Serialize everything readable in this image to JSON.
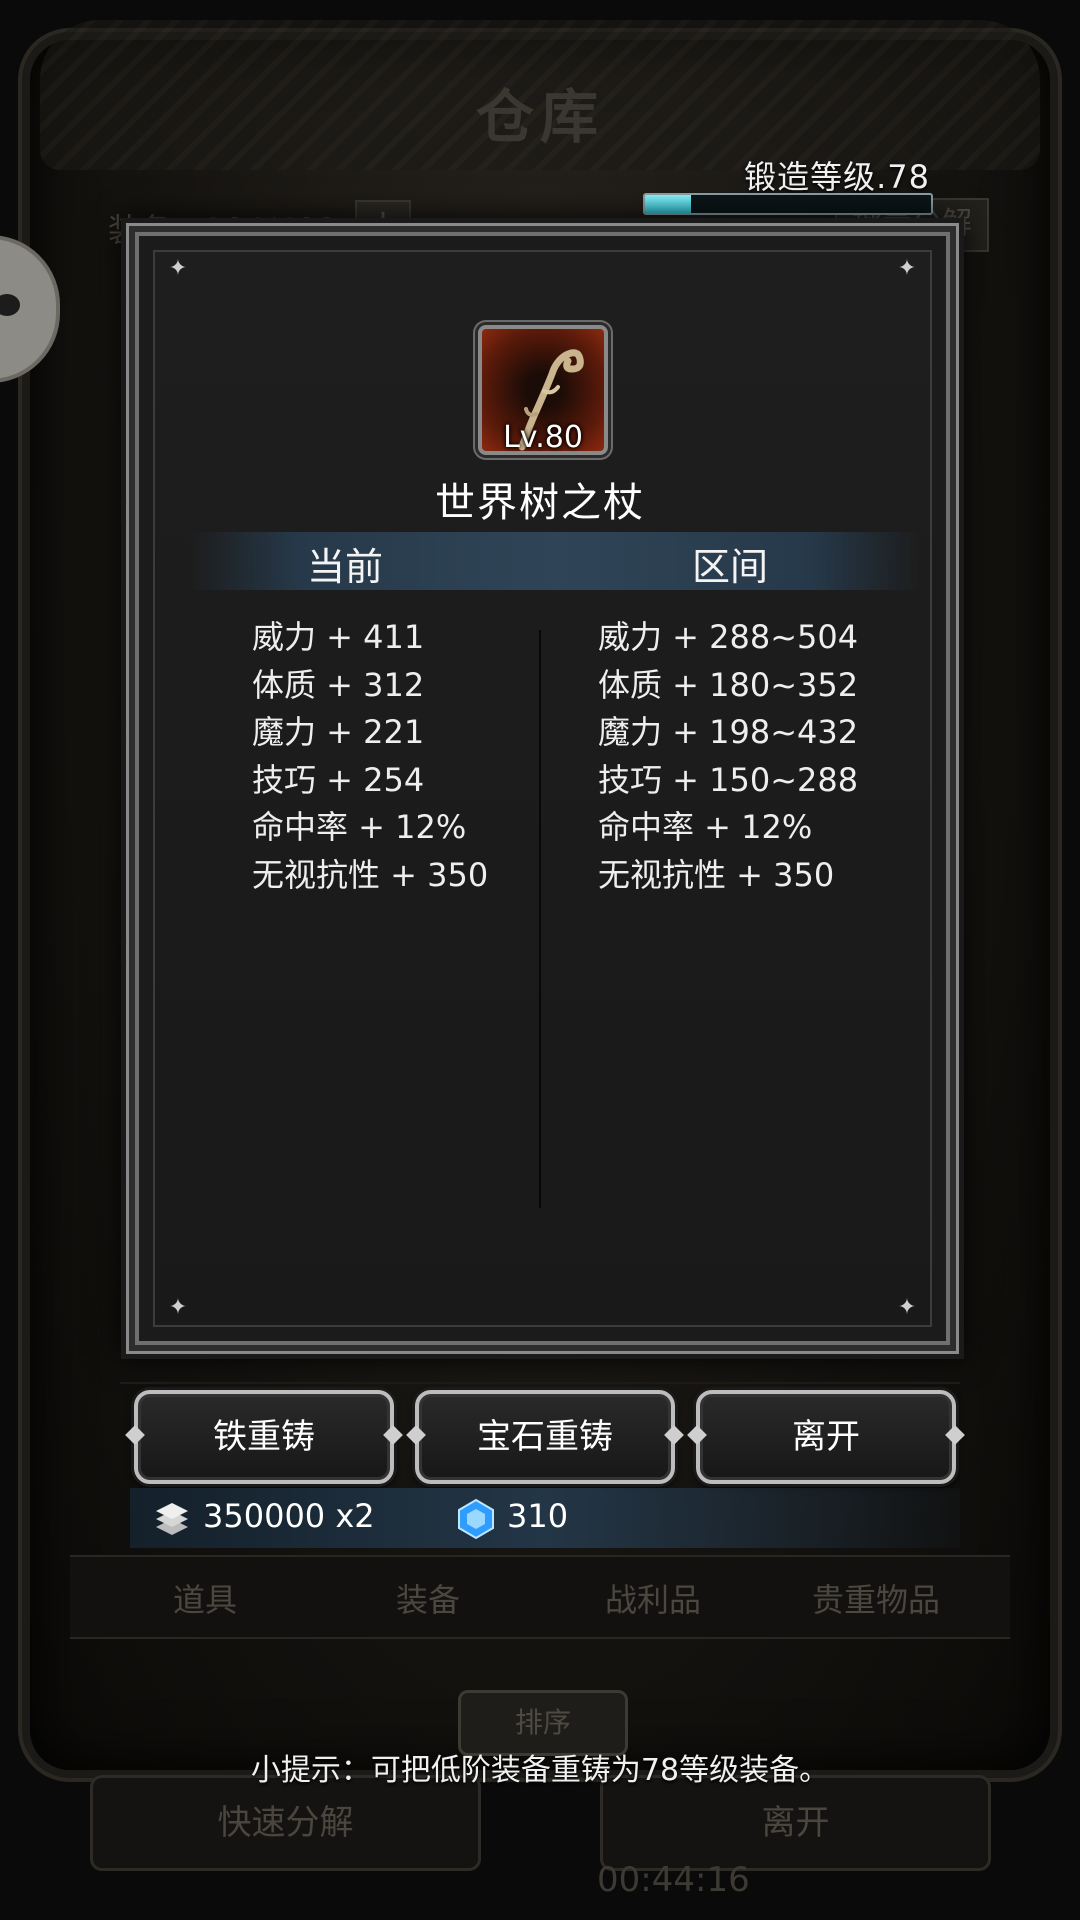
{
  "background": {
    "title": "仓库",
    "equip_count": "装备：304/400",
    "plus": "+",
    "batch_label": "批量分解",
    "tabs": [
      "道具",
      "装备",
      "战利品",
      "贵重物品"
    ],
    "sort_label": "排序",
    "quick_label": "快速分解",
    "leave_label": "离开",
    "timer": "00:44:16"
  },
  "forge": {
    "level_label": "锻造等级.78",
    "progress": 0.16
  },
  "item": {
    "icon": "staff-icon",
    "level": "Lv.80",
    "name": "世界树之杖"
  },
  "columns": {
    "current": "当前",
    "range": "区间"
  },
  "stats_current": [
    "威力 + 411",
    "体质 + 312",
    "魔力 + 221",
    "技巧 + 254",
    "命中率 + 12%",
    "无视抗性 + 350"
  ],
  "stats_range": [
    "威力 + 288~504",
    "体质 + 180~352",
    "魔力 + 198~432",
    "技巧 + 150~288",
    "命中率 + 12%",
    "无视抗性 + 350"
  ],
  "buttons": {
    "iron": "铁重铸",
    "gem": "宝石重铸",
    "leave": "离开"
  },
  "cost": {
    "iron_icon": "iron-ingot-icon",
    "iron": "350000 x2",
    "gem_icon": "blue-gem-icon",
    "gem": "310"
  },
  "tip": "小提示：可把低阶装备重铸为78等级装备。",
  "colors": {
    "progress_fill": "#2fc3d3",
    "header_band": "#2f4557",
    "gem_blue": "#2f9cff"
  }
}
